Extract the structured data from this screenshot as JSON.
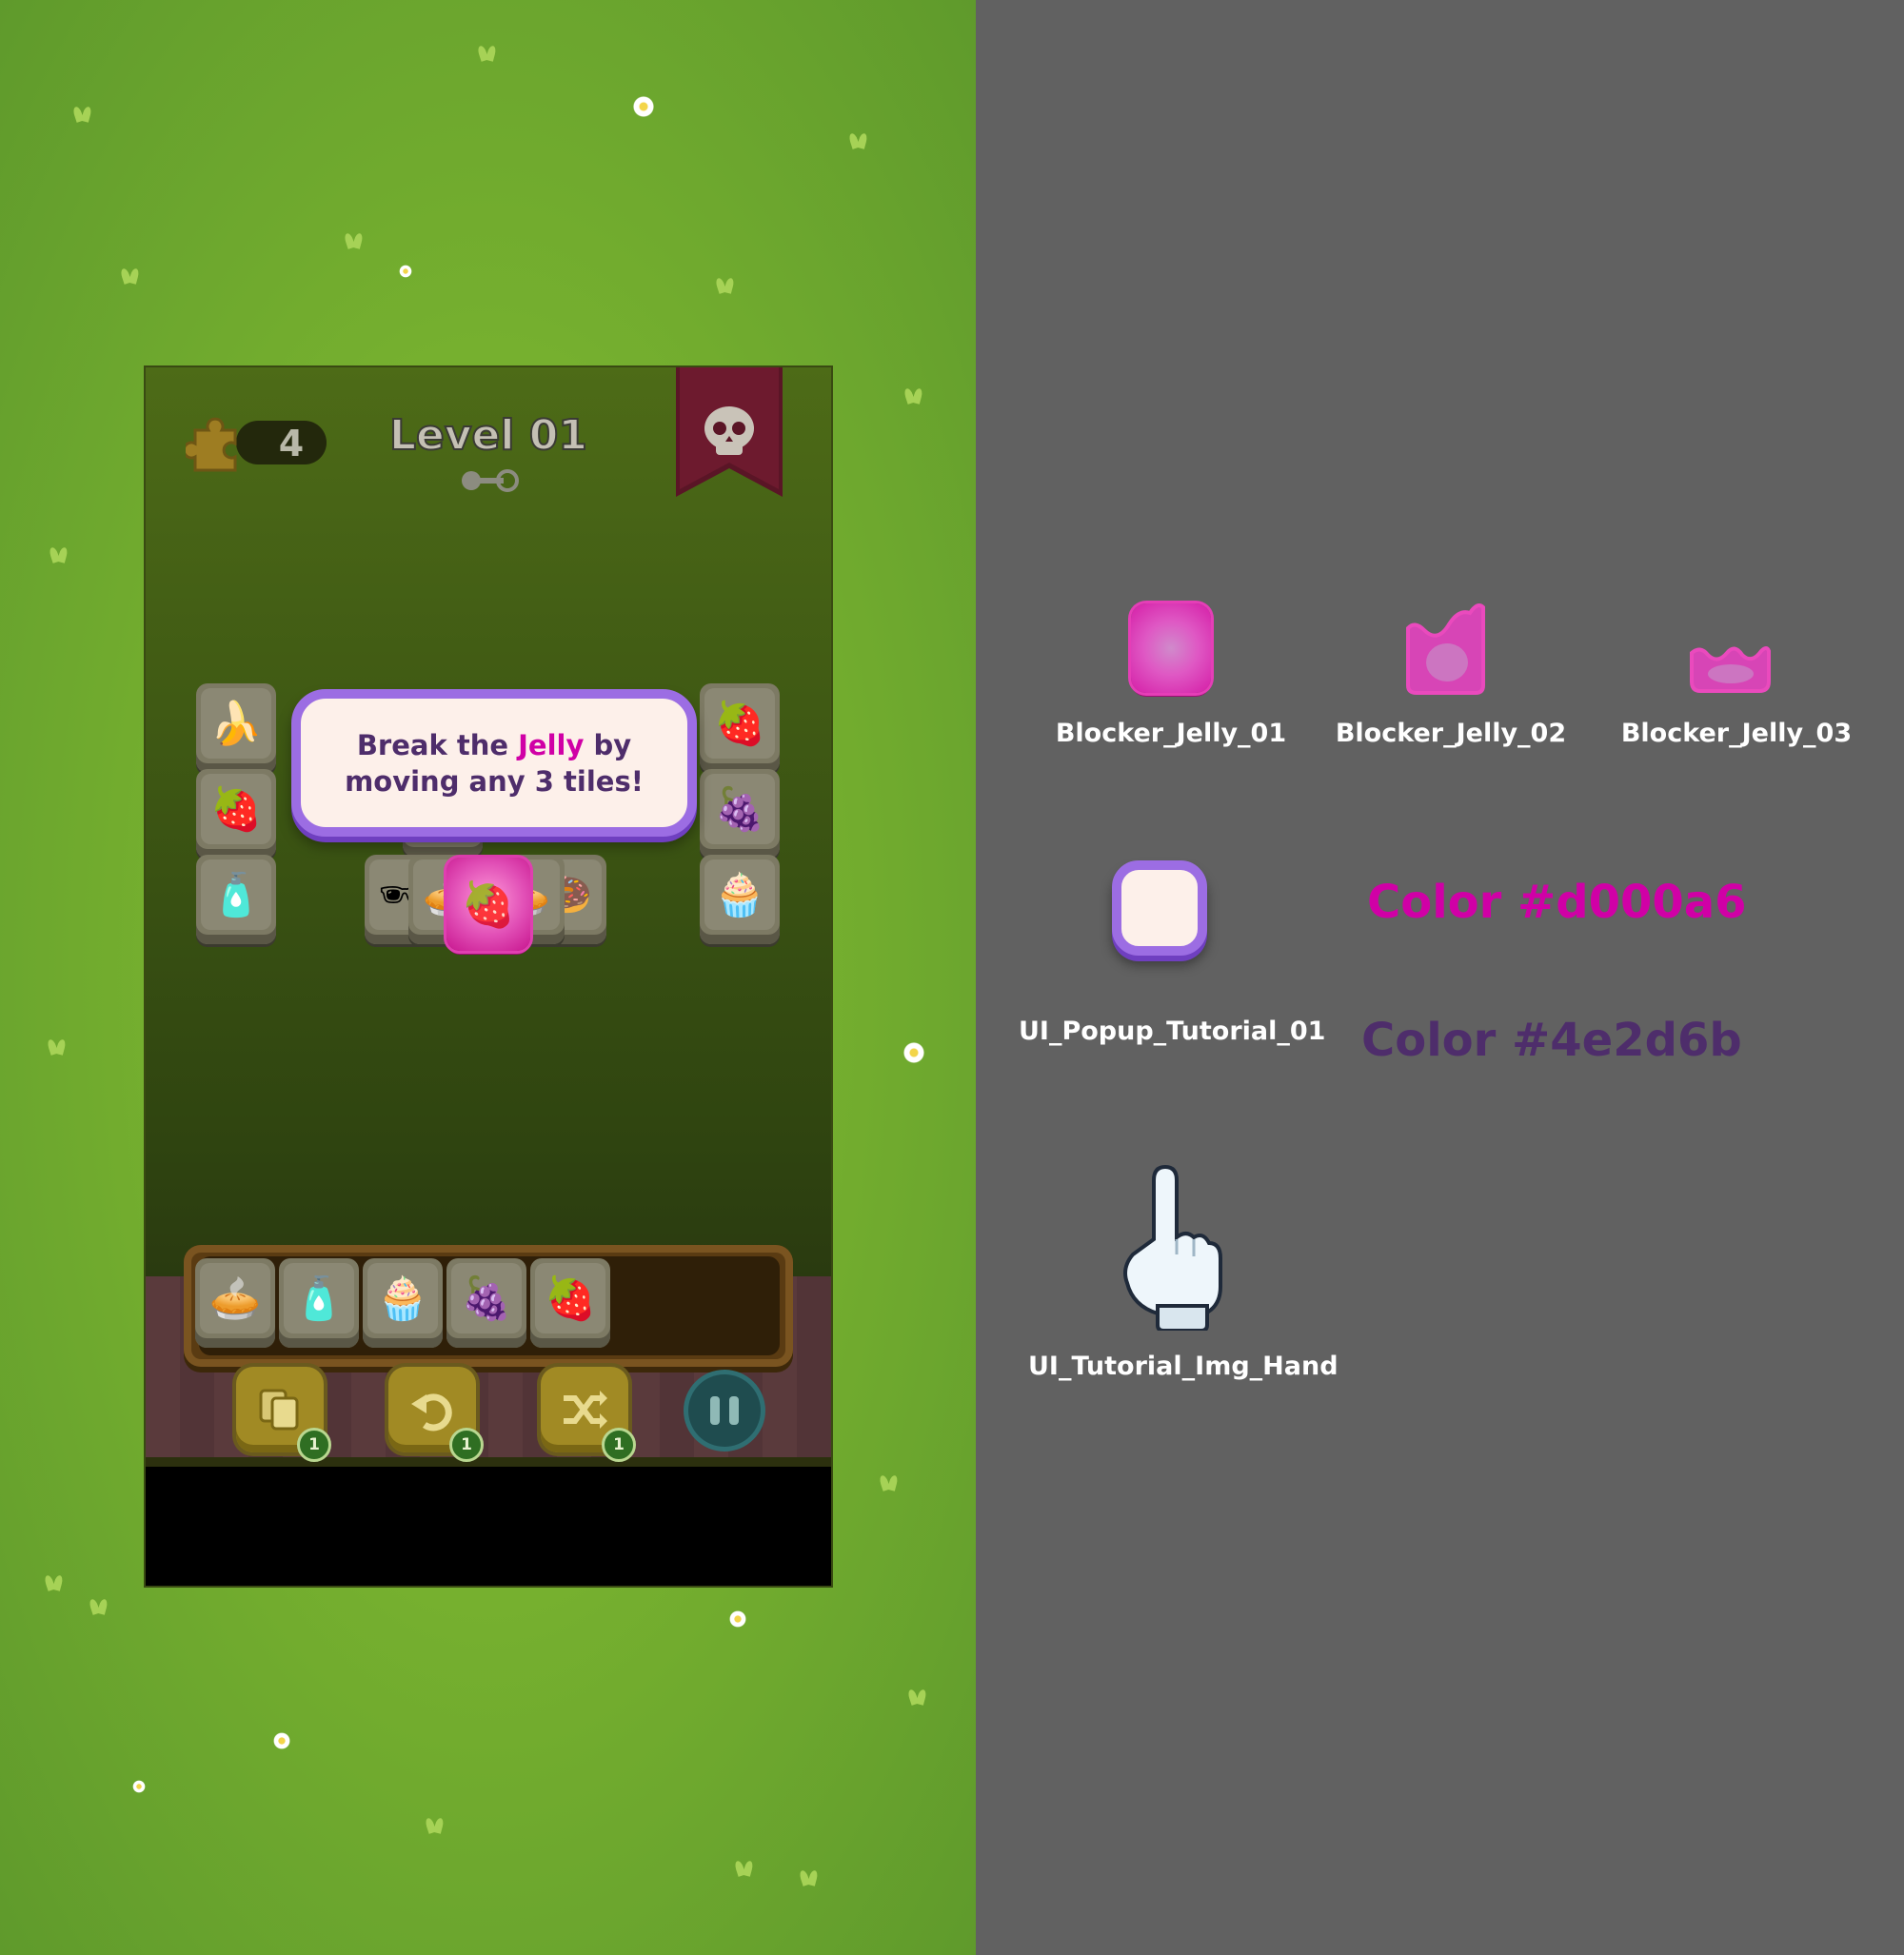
{
  "game": {
    "puzzle_count": "4",
    "level_title": "Level 01",
    "tutorial_text_before": "Break the ",
    "tutorial_highlight": "Jelly",
    "tutorial_text_after": " by moving any 3 tiles!",
    "booster_badges": [
      "1",
      "1",
      "1"
    ],
    "board_tiles": [
      "banana",
      "strawberry",
      "water-bottle",
      "strawberry",
      "grapes",
      "cupcake"
    ],
    "tray_tiles": [
      "pie",
      "water-bottle",
      "cupcake",
      "grapes",
      "strawberry"
    ]
  },
  "assets": {
    "jelly_01_label": "Blocker_Jelly_01",
    "jelly_02_label": "Blocker_Jelly_02",
    "jelly_03_label": "Blocker_Jelly_03",
    "popup_label": "UI_Popup_Tutorial_01",
    "hand_label": "UI_Tutorial_Img_Hand",
    "color_1_label": "Color #d000a6",
    "color_2_label": "Color #4e2d6b"
  },
  "colors": {
    "highlight": "#d000a6",
    "text": "#4e2d6b",
    "sheet_background": "#616161",
    "grass": "#76b02f"
  },
  "icons": [
    "puzzle-piece-icon",
    "skull-icon",
    "key-progress-icon",
    "cards-icon",
    "undo-icon",
    "shuffle-icon",
    "pause-icon",
    "hand-pointer-icon"
  ]
}
